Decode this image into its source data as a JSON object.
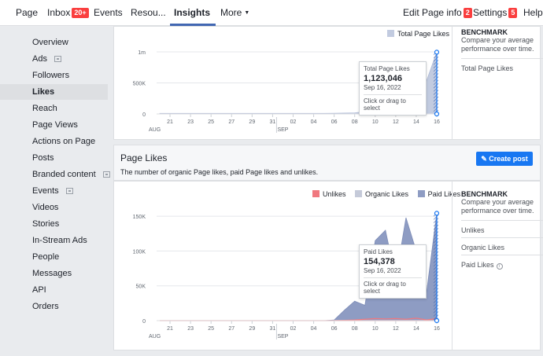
{
  "topnav": {
    "left": [
      {
        "label": "Page"
      },
      {
        "label": "Inbox",
        "badge": "20+"
      },
      {
        "label": "Events"
      },
      {
        "label": "Resou..."
      },
      {
        "label": "Insights",
        "active": true
      },
      {
        "label": "More"
      }
    ],
    "right": [
      {
        "label": "Edit Page info",
        "badge": "2"
      },
      {
        "label": "Settings",
        "badge": "5"
      },
      {
        "label": "Help"
      }
    ]
  },
  "sidebar": {
    "items": [
      {
        "label": "Overview"
      },
      {
        "label": "Ads",
        "icon": true
      },
      {
        "label": "Followers"
      },
      {
        "label": "Likes",
        "active": true
      },
      {
        "label": "Reach"
      },
      {
        "label": "Page Views"
      },
      {
        "label": "Actions on Page"
      },
      {
        "label": "Posts"
      },
      {
        "label": "Branded content",
        "icon": true
      },
      {
        "label": "Events",
        "icon": true
      },
      {
        "label": "Videos"
      },
      {
        "label": "Stories"
      },
      {
        "label": "In-Stream Ads"
      },
      {
        "label": "People"
      },
      {
        "label": "Messages"
      },
      {
        "label": "API"
      },
      {
        "label": "Orders"
      }
    ]
  },
  "total_likes": {
    "legend": "Total Page Likes",
    "tooltip": {
      "title": "Total Page Likes",
      "value": "1,123,046",
      "date": "Sep 16, 2022",
      "hint": "Click or drag to select"
    },
    "benchmark": {
      "title": "BENCHMARK",
      "desc": "Compare your average performance over time.",
      "items": [
        "Total Page Likes"
      ]
    }
  },
  "page_likes": {
    "title": "Page Likes",
    "desc": "The number of organic Page likes, paid Page likes and unlikes.",
    "create_post": "Create post",
    "legend": [
      "Unlikes",
      "Organic Likes",
      "Paid Likes"
    ],
    "tooltip": {
      "title": "Paid Likes",
      "value": "154,378",
      "date": "Sep 16, 2022",
      "hint": "Click or drag to select"
    },
    "benchmark": {
      "title": "BENCHMARK",
      "desc": "Compare your average performance over time.",
      "items": [
        "Unlikes",
        "Organic Likes",
        "Paid Likes"
      ]
    }
  },
  "colors": {
    "unlikes": "#f0787f",
    "organic": "#c5cad9",
    "paid": "#8e9cc3",
    "total": "#c2cbe0",
    "accent": "#1877f2"
  },
  "chart_data": [
    {
      "type": "area",
      "title": "",
      "xlabel": "",
      "ylabel": "",
      "x_ticks": [
        "21",
        "23",
        "25",
        "27",
        "29",
        "31",
        "02",
        "04",
        "06",
        "08",
        "10",
        "12",
        "14",
        "16"
      ],
      "x_months": [
        "AUG",
        "SEP"
      ],
      "y_ticks": [
        "0",
        "500K",
        "1m"
      ],
      "ylim": [
        0,
        1200000
      ],
      "x": [
        "Aug 20",
        "Aug 21",
        "Aug 22",
        "Aug 23",
        "Aug 24",
        "Aug 25",
        "Aug 26",
        "Aug 27",
        "Aug 28",
        "Aug 29",
        "Aug 30",
        "Aug 31",
        "Sep 01",
        "Sep 02",
        "Sep 03",
        "Sep 04",
        "Sep 05",
        "Sep 06",
        "Sep 07",
        "Sep 08",
        "Sep 09",
        "Sep 10",
        "Sep 11",
        "Sep 12",
        "Sep 13",
        "Sep 14",
        "Sep 15",
        "Sep 16"
      ],
      "series": [
        {
          "name": "Total Page Likes",
          "values": [
            10000,
            10000,
            10000,
            10000,
            10000,
            10000,
            10000,
            10000,
            10000,
            10000,
            10000,
            10000,
            10000,
            10000,
            10000,
            10000,
            10000,
            12000,
            15000,
            20000,
            40000,
            80000,
            160000,
            250000,
            330000,
            420000,
            600000,
            1123046
          ]
        }
      ]
    },
    {
      "type": "area",
      "title": "",
      "xlabel": "",
      "ylabel": "",
      "x_ticks": [
        "21",
        "23",
        "25",
        "27",
        "29",
        "31",
        "02",
        "04",
        "06",
        "08",
        "10",
        "12",
        "14",
        "16"
      ],
      "x_months": [
        "AUG",
        "SEP"
      ],
      "y_ticks": [
        "0",
        "50K",
        "100K",
        "150K"
      ],
      "ylim": [
        0,
        165000
      ],
      "x": [
        "Aug 20",
        "Aug 21",
        "Aug 22",
        "Aug 23",
        "Aug 24",
        "Aug 25",
        "Aug 26",
        "Aug 27",
        "Aug 28",
        "Aug 29",
        "Aug 30",
        "Aug 31",
        "Sep 01",
        "Sep 02",
        "Sep 03",
        "Sep 04",
        "Sep 05",
        "Sep 06",
        "Sep 07",
        "Sep 08",
        "Sep 09",
        "Sep 10",
        "Sep 11",
        "Sep 12",
        "Sep 13",
        "Sep 14",
        "Sep 15",
        "Sep 16"
      ],
      "series": [
        {
          "name": "Unlikes",
          "values": [
            0,
            0,
            0,
            0,
            0,
            0,
            0,
            0,
            0,
            0,
            0,
            0,
            0,
            0,
            0,
            0,
            0,
            200,
            500,
            1000,
            2000,
            3000,
            2500,
            3000,
            2000,
            3500,
            1000,
            3000
          ]
        },
        {
          "name": "Organic Likes",
          "values": [
            0,
            0,
            0,
            0,
            0,
            0,
            0,
            0,
            0,
            0,
            0,
            0,
            0,
            0,
            0,
            0,
            0,
            0,
            0,
            0,
            0,
            0,
            0,
            0,
            0,
            0,
            0,
            0
          ]
        },
        {
          "name": "Paid Likes",
          "values": [
            0,
            0,
            0,
            0,
            0,
            0,
            0,
            0,
            0,
            0,
            0,
            0,
            0,
            0,
            0,
            0,
            0,
            1000,
            15000,
            28000,
            22000,
            115000,
            130000,
            60000,
            148000,
            100000,
            40000,
            154378
          ]
        }
      ]
    }
  ]
}
